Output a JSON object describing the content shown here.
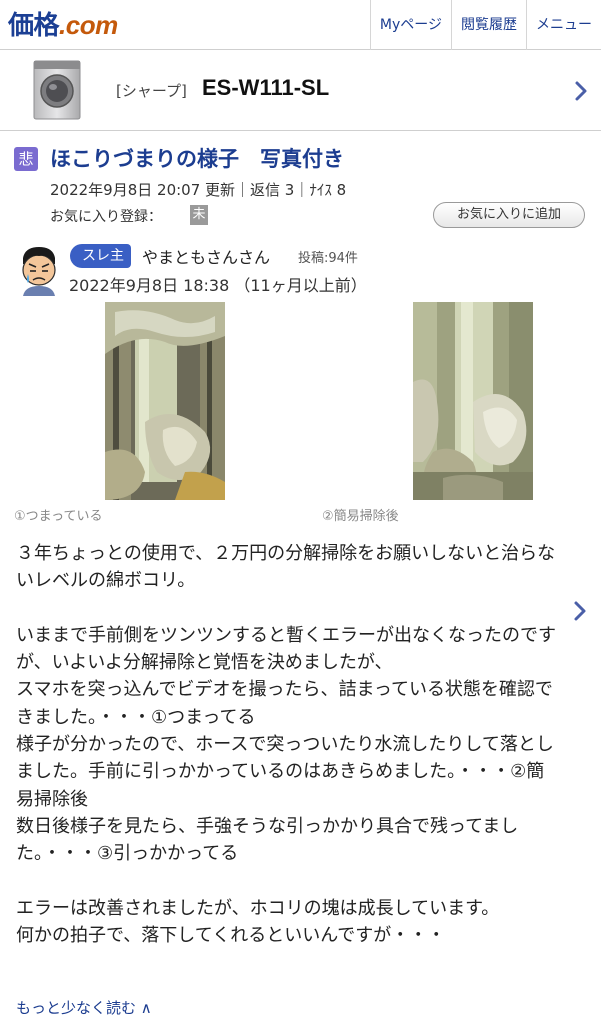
{
  "header": {
    "logo_kakaku": "価格",
    "logo_dot": ".",
    "logo_com": "com",
    "nav": [
      {
        "label": "Myページ"
      },
      {
        "label": "閲覧履歴"
      },
      {
        "label": "メニュー"
      }
    ]
  },
  "product": {
    "maker": "[シャープ]",
    "model": "ES-W111-SL"
  },
  "thread": {
    "mood": "悲",
    "title": "ほこりづまりの様子　写真付き",
    "meta": "2022年9月8日 20:07 更新｜返信 3｜ﾅｲｽ 8",
    "fav_label": "お気に入り登録：",
    "fav_state": "未",
    "fav_button": "お気に入りに追加"
  },
  "post": {
    "owner_badge": "スレ主",
    "username": "やまともさんさん",
    "post_count": "投稿:94件",
    "date": "2022年9月8日 18:38 （11ヶ月以上前）",
    "photos": [
      {
        "caption": "①つまっている"
      },
      {
        "caption": "②簡易掃除後"
      }
    ],
    "lines": [
      "３年ちょっとの使用で、２万円の分解掃除をお願いしないと治らないレベルの綿ボコリ。",
      "",
      "いままで手前側をツンツンすると暫くエラーが出なくなったのですが、いよいよ分解掃除と覚悟を決めましたが、",
      "スマホを突っ込んでビデオを撮ったら、詰まっている状態を確認できました。・・・①つまってる",
      "様子が分かったので、ホースで突っついたり水流したりして落としました。手前に引っかかっているのはあきらめました。・・・②簡易掃除後",
      "数日後様子を見たら、手強そうな引っかかり具合で残ってました。・・・③引っかかってる",
      "",
      "エラーは改善されましたが、ホコリの塊は成長しています。",
      "何かの拍子で、落下してくれるといいんですが・・・"
    ],
    "read_less": "もっと少なく読む ∧"
  },
  "colors": {
    "link": "#1c3d90",
    "logo_blue": "#1b3f94",
    "logo_orange": "#c4590b",
    "mood_badge": "#7a6bd0",
    "owner_badge": "#3a5fc4"
  }
}
